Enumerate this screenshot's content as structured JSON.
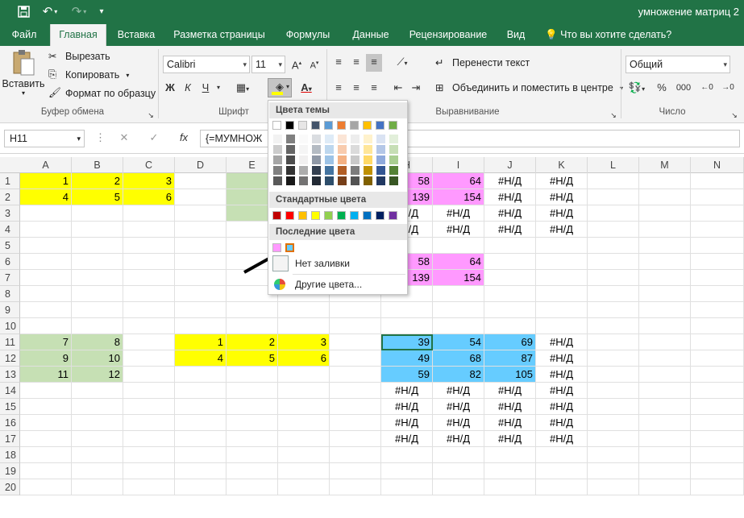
{
  "window": {
    "title": "умножение матриц 2"
  },
  "quick_access": {
    "save_icon": "save-icon",
    "undo_icon": "undo-icon",
    "redo_icon": "redo-icon",
    "customize_icon": "customize-icon"
  },
  "tabs": [
    "Файл",
    "Главная",
    "Вставка",
    "Разметка страницы",
    "Формулы",
    "Данные",
    "Рецензирование",
    "Вид"
  ],
  "tell_me": "Что вы хотите сделать?",
  "clipboard": {
    "paste": "Вставить",
    "cut": "Вырезать",
    "copy": "Копировать",
    "format_painter": "Формат по образцу",
    "group": "Буфер обмена"
  },
  "font": {
    "name": "Calibri",
    "size": "11",
    "bold": "Ж",
    "italic": "К",
    "underline": "Ч",
    "group": "Шрифт"
  },
  "alignment": {
    "wrap": "Перенести текст",
    "merge": "Объединить и поместить в центре",
    "group": "Выравнивание"
  },
  "number": {
    "format": "Общий",
    "percent": "%",
    "thousands": "000",
    "group": "Число"
  },
  "formula_bar": {
    "name_box": "H11",
    "fx": "fx",
    "formula": "{=МУМНОЖ"
  },
  "columns": [
    "A",
    "B",
    "C",
    "D",
    "E",
    "F",
    "G",
    "H",
    "I",
    "J",
    "K",
    "L",
    "M",
    "N"
  ],
  "rows": [
    "1",
    "2",
    "3",
    "4",
    "5",
    "6",
    "7",
    "8",
    "9",
    "10",
    "11",
    "12",
    "13",
    "14",
    "15",
    "16",
    "17",
    "18",
    "19",
    "20"
  ],
  "cells": {
    "A1": "1",
    "B1": "2",
    "C1": "3",
    "A2": "4",
    "B2": "5",
    "C2": "6",
    "E3": "1",
    "H1": "58",
    "I1": "64",
    "J1": "#Н/Д",
    "K1": "#Н/Д",
    "H2": "139",
    "I2": "154",
    "J2": "#Н/Д",
    "K2": "#Н/Д",
    "H3": "#Н/Д",
    "I3": "#Н/Д",
    "J3": "#Н/Д",
    "K3": "#Н/Д",
    "H4": "#Н/Д",
    "I4": "#Н/Д",
    "J4": "#Н/Д",
    "K4": "#Н/Д",
    "H6": "58",
    "I6": "64",
    "H7": "139",
    "I7": "154",
    "A11": "7",
    "B11": "8",
    "A12": "9",
    "B12": "10",
    "A13": "11",
    "B13": "12",
    "D11": "1",
    "E11": "2",
    "F11": "3",
    "D12": "4",
    "E12": "5",
    "F12": "6",
    "H11": "39",
    "I11": "54",
    "J11": "69",
    "K11": "#Н/Д",
    "H12": "49",
    "I12": "68",
    "J12": "87",
    "K12": "#Н/Д",
    "H13": "59",
    "I13": "82",
    "J13": "105",
    "K13": "#Н/Д",
    "H14": "#Н/Д",
    "I14": "#Н/Д",
    "J14": "#Н/Д",
    "K14": "#Н/Д",
    "H15": "#Н/Д",
    "I15": "#Н/Д",
    "J15": "#Н/Д",
    "K15": "#Н/Д",
    "H16": "#Н/Д",
    "I16": "#Н/Д",
    "J16": "#Н/Д",
    "K16": "#Н/Д",
    "H17": "#Н/Д",
    "I17": "#Н/Д",
    "J17": "#Н/Д",
    "K17": "#Н/Д"
  },
  "fills": {
    "yellow": "#ffff00",
    "green": "#c6e0b4",
    "pink": "#ff99ff",
    "blue": "#66ccff"
  },
  "fill_popup": {
    "theme_header": "Цвета темы",
    "standard_header": "Стандартные цвета",
    "recent_header": "Последние цвета",
    "no_fill": "Нет заливки",
    "more_colors": "Другие цвета...",
    "theme_colors": [
      "#ffffff",
      "#000000",
      "#e7e6e6",
      "#44546a",
      "#5b9bd5",
      "#ed7d31",
      "#a5a5a5",
      "#ffc000",
      "#4472c4",
      "#70ad47"
    ],
    "standard_colors": [
      "#c00000",
      "#ff0000",
      "#ffc000",
      "#ffff00",
      "#92d050",
      "#00b050",
      "#00b0f0",
      "#0070c0",
      "#002060",
      "#7030a0"
    ],
    "recent_colors": [
      "#ff99ff",
      "#66ccff"
    ]
  }
}
